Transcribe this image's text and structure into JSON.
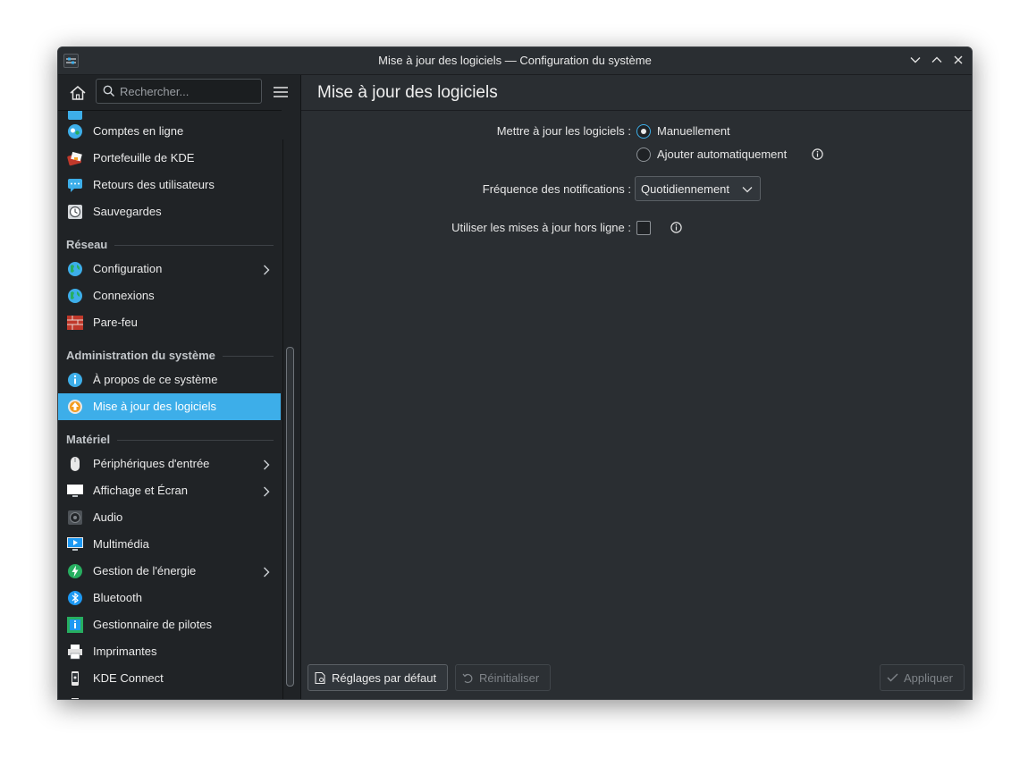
{
  "window": {
    "title": "Mise à jour des logiciels — Configuration du système"
  },
  "sidebar": {
    "search_placeholder": "Rechercher...",
    "items": [
      {
        "label": "Comptes en ligne",
        "icon": "online-accounts-icon"
      },
      {
        "label": "Portefeuille de KDE",
        "icon": "kde-wallet-icon"
      },
      {
        "label": "Retours des utilisateurs",
        "icon": "user-feedback-icon"
      },
      {
        "label": "Sauvegardes",
        "icon": "backups-icon"
      }
    ],
    "sections": [
      {
        "title": "Réseau",
        "items": [
          {
            "label": "Configuration",
            "icon": "network-globe-icon",
            "has_children": true
          },
          {
            "label": "Connexions",
            "icon": "network-globe-icon"
          },
          {
            "label": "Pare-feu",
            "icon": "firewall-icon"
          }
        ]
      },
      {
        "title": "Administration du système",
        "items": [
          {
            "label": "À propos de ce système",
            "icon": "info-icon"
          },
          {
            "label": "Mise à jour des logiciels",
            "icon": "software-update-icon",
            "active": true
          }
        ]
      },
      {
        "title": "Matériel",
        "items": [
          {
            "label": "Périphériques d'entrée",
            "icon": "mouse-icon",
            "has_children": true
          },
          {
            "label": "Affichage et Écran",
            "icon": "display-icon",
            "has_children": true
          },
          {
            "label": "Audio",
            "icon": "speaker-icon"
          },
          {
            "label": "Multimédia",
            "icon": "multimedia-icon"
          },
          {
            "label": "Gestion de l'énergie",
            "icon": "power-icon",
            "has_children": true
          },
          {
            "label": "Bluetooth",
            "icon": "bluetooth-icon"
          },
          {
            "label": "Gestionnaire de pilotes",
            "icon": "driver-manager-icon"
          },
          {
            "label": "Imprimantes",
            "icon": "printer-icon"
          },
          {
            "label": "KDE Connect",
            "icon": "phone-icon"
          }
        ]
      }
    ]
  },
  "main": {
    "title": "Mise à jour des logiciels",
    "update_label": "Mettre à jour les logiciels :",
    "radio_manual": "Manuellement",
    "radio_auto": "Ajouter automatiquement",
    "selected_mode": "Manuellement",
    "frequency_label": "Fréquence des notifications :",
    "frequency_value": "Quotidiennement",
    "offline_label": "Utiliser les mises à jour hors ligne :",
    "offline_checked": false
  },
  "footer": {
    "defaults_label": "Réglages par défaut",
    "reset_label": "Réinitialiser",
    "apply_label": "Appliquer"
  },
  "colors": {
    "accent": "#3daee9",
    "window_bg": "#202326",
    "content_bg": "#2a2e32"
  }
}
